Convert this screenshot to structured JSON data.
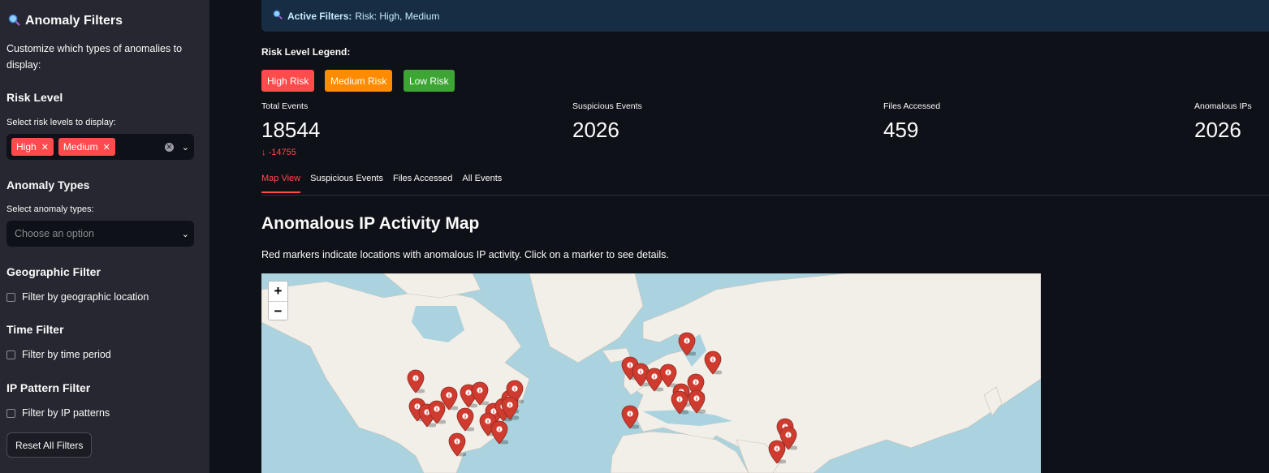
{
  "sidebar": {
    "title": "Anomaly Filters",
    "title_icon": "magnifier-icon",
    "description": "Customize which types of anomalies to display:",
    "risk_level": {
      "heading": "Risk Level",
      "label": "Select risk levels to display:",
      "selected": [
        "High",
        "Medium"
      ]
    },
    "anomaly_types": {
      "heading": "Anomaly Types",
      "label": "Select anomaly types:",
      "placeholder": "Choose an option"
    },
    "geo": {
      "heading": "Geographic Filter",
      "checkbox": "Filter by geographic location",
      "checked": false
    },
    "time": {
      "heading": "Time Filter",
      "checkbox": "Filter by time period",
      "checked": false
    },
    "ip": {
      "heading": "IP Pattern Filter",
      "checkbox": "Filter by IP patterns",
      "checked": false
    },
    "reset_button": "Reset All Filters"
  },
  "banner": {
    "icon": "magnifier-icon",
    "label": "Active Filters:",
    "value": "Risk: High, Medium"
  },
  "legend": {
    "label": "Risk Level Legend:",
    "items": [
      {
        "label": "High Risk",
        "color": "#ff4b4b"
      },
      {
        "label": "Medium Risk",
        "color": "#ff8c00"
      },
      {
        "label": "Low Risk",
        "color": "#3ca534"
      }
    ]
  },
  "metrics": [
    {
      "label": "Total Events",
      "value": "18544",
      "delta": "-14755"
    },
    {
      "label": "Suspicious Events",
      "value": "2026"
    },
    {
      "label": "Files Accessed",
      "value": "459"
    },
    {
      "label": "Anomalous IPs",
      "value": "2026"
    }
  ],
  "tabs": [
    "Map View",
    "Suspicious Events",
    "Files Accessed",
    "All Events"
  ],
  "active_tab": "Map View",
  "map": {
    "title": "Anomalous IP Activity Map",
    "description": "Red markers indicate locations with anomalous IP activity. Click on a marker to see details.",
    "zoom_in": "+",
    "zoom_out": "−",
    "marker_color": "#d03b2f"
  }
}
